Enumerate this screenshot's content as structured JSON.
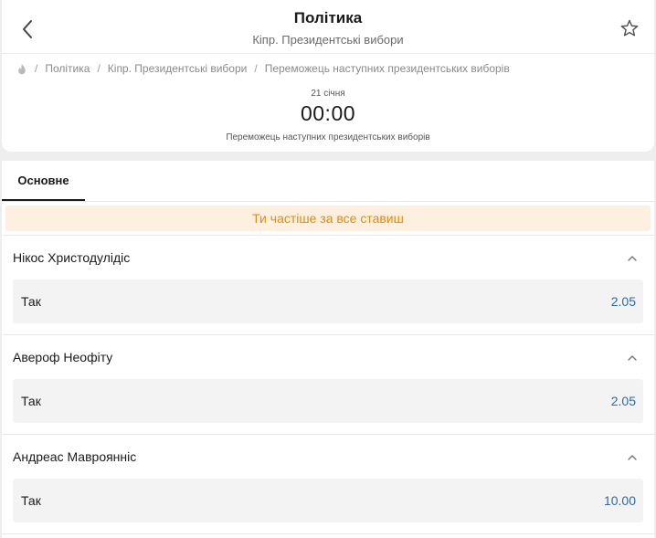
{
  "header": {
    "title": "Політика",
    "subtitle": "Кіпр. Президентські вибори"
  },
  "breadcrumb": {
    "items": [
      "Політика",
      "Кіпр. Президентські вибори",
      "Переможець наступних президентських виборів"
    ],
    "separator": "/"
  },
  "event": {
    "date": "21 січня",
    "time": "00:00",
    "name": "Переможець наступних президентських виборів"
  },
  "tabs": [
    {
      "label": "Основне",
      "active": true
    }
  ],
  "banner": {
    "text": "Ти частіше за все ставиш"
  },
  "markets": [
    {
      "title": "Нікос Христодулідіс",
      "outcomes": [
        {
          "label": "Так",
          "odds": "2.05"
        }
      ]
    },
    {
      "title": "Авероф Неофіту",
      "outcomes": [
        {
          "label": "Так",
          "odds": "2.05"
        }
      ]
    },
    {
      "title": "Андреас Мавроянніс",
      "outcomes": [
        {
          "label": "Так",
          "odds": "10.00"
        }
      ]
    }
  ],
  "colors": {
    "accent_odds": "#2d6aa6",
    "banner_text": "#e38a0c",
    "banner_bg": "#fdf0e1",
    "page_bg": "#eeeeee"
  },
  "icons": {
    "back": "chevron-left-icon",
    "favorite": "star-outline-icon",
    "home": "flame-icon",
    "collapse": "chevron-up-icon"
  }
}
